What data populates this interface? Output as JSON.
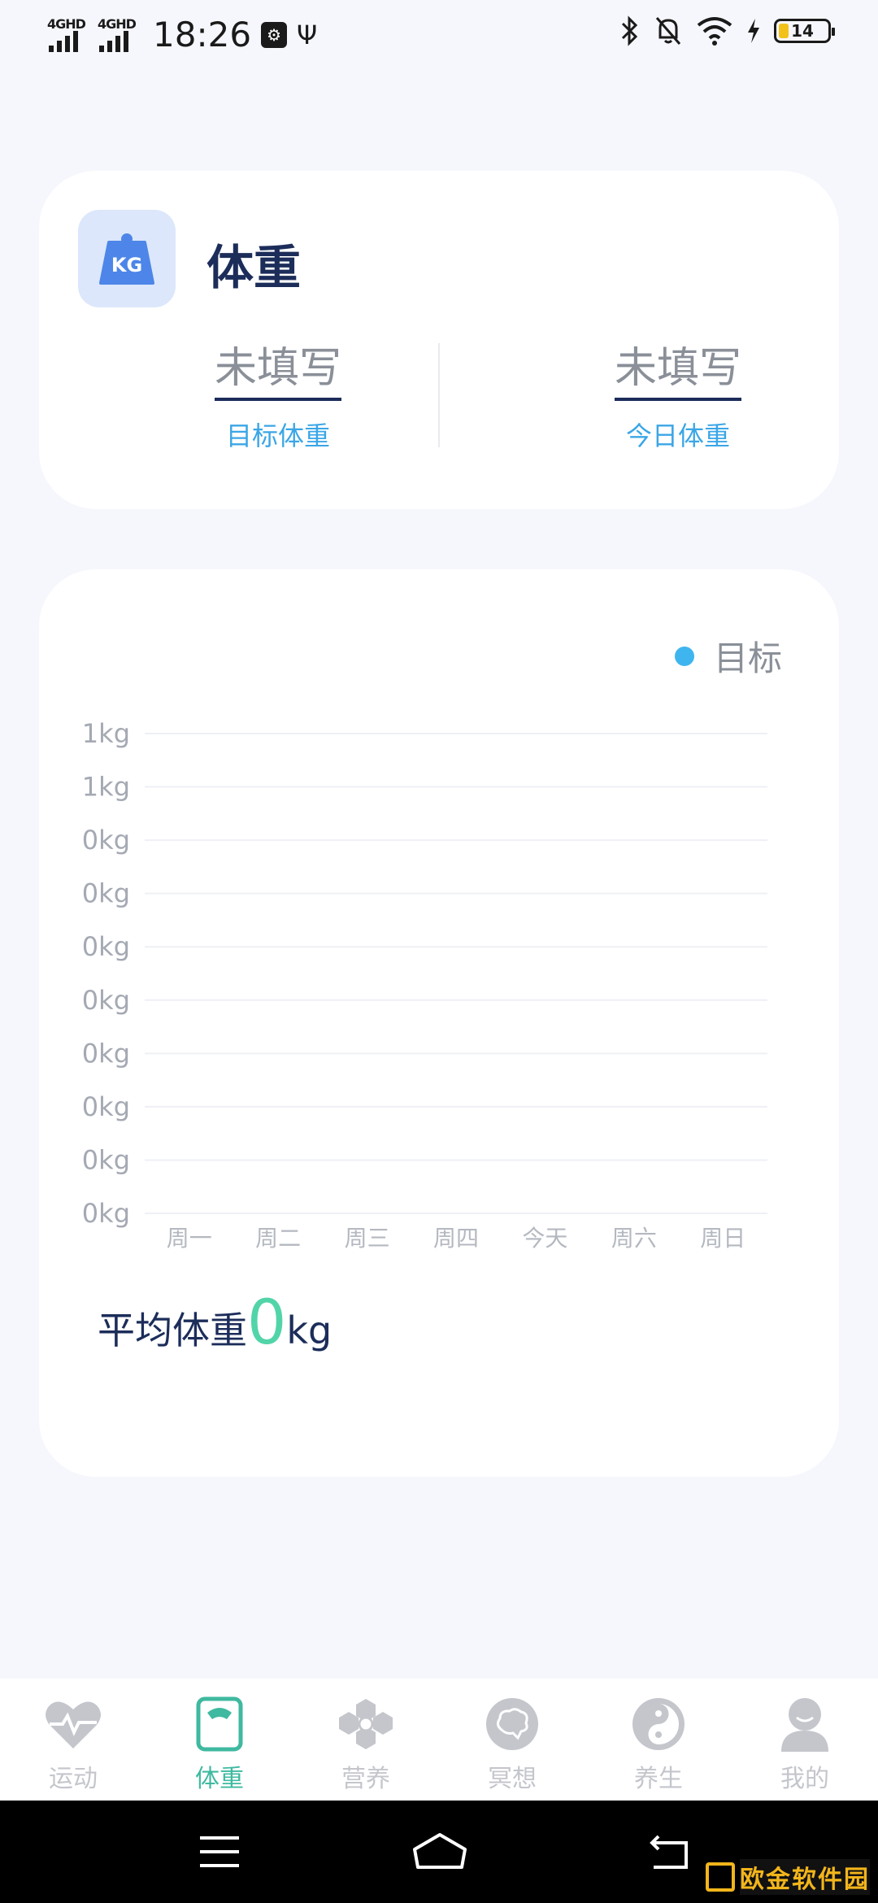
{
  "status_bar": {
    "network_1": "4GHD",
    "network_2": "4GHD",
    "time": "18:26",
    "usb_icon": "usb-debug-icon",
    "battery": "14",
    "battery_color": "#f2c21b"
  },
  "weight_card": {
    "icon_text": "KG",
    "title": "体重",
    "target": {
      "value": "未填写",
      "label": "目标体重"
    },
    "today": {
      "value": "未填写",
      "label": "今日体重"
    }
  },
  "chart_data": {
    "type": "line",
    "legend": [
      {
        "name": "目标",
        "color": "#3fb5f0"
      }
    ],
    "legend_position": "top-right",
    "categories": [
      "周一",
      "周二",
      "周三",
      "周四",
      "今天",
      "周六",
      "周日"
    ],
    "y_tick_labels": [
      "1kg",
      "1kg",
      "0kg",
      "0kg",
      "0kg",
      "0kg",
      "0kg",
      "0kg",
      "0kg",
      "0kg"
    ],
    "series": [
      {
        "name": "目标",
        "values": [
          0,
          0,
          0,
          0,
          0,
          0,
          0
        ]
      }
    ],
    "ylim": [
      0,
      1
    ],
    "grid": true
  },
  "average": {
    "label": "平均体重",
    "value": "0",
    "unit": "kg"
  },
  "tabs": [
    {
      "label": "运动",
      "icon": "heart-pulse-icon",
      "active": false
    },
    {
      "label": "体重",
      "icon": "scale-icon",
      "active": true
    },
    {
      "label": "营养",
      "icon": "nutrition-hex-icon",
      "active": false
    },
    {
      "label": "冥想",
      "icon": "brain-icon",
      "active": false
    },
    {
      "label": "养生",
      "icon": "yin-yang-icon",
      "active": false
    },
    {
      "label": "我的",
      "icon": "user-icon",
      "active": false
    }
  ],
  "colors": {
    "accent": "#3fb9a0",
    "label_blue": "#3ba6e6",
    "title": "#1c2d5a",
    "inactive": "#c4c6cc"
  },
  "watermark": "欧金软件园"
}
